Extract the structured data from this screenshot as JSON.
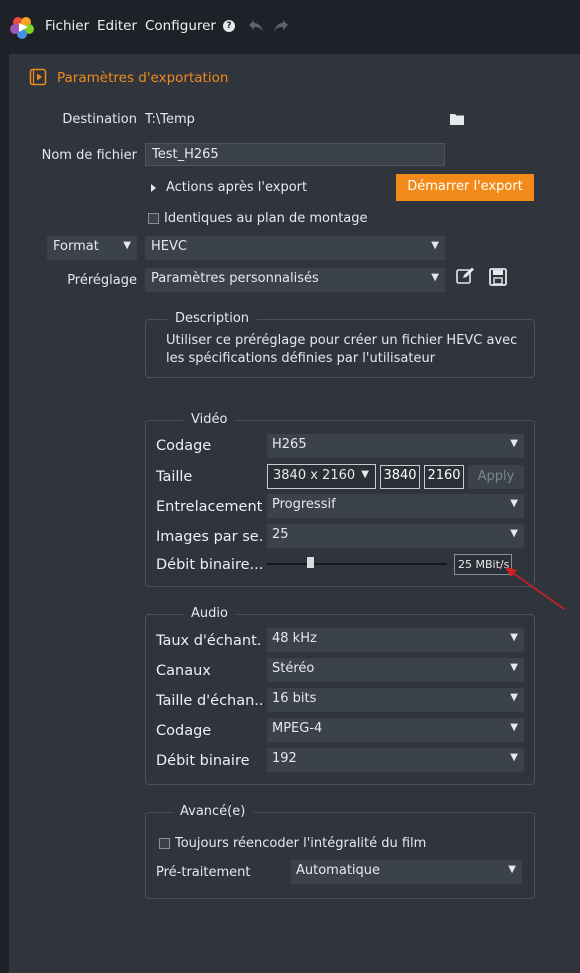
{
  "menu": {
    "items": [
      "Fichier",
      "Editer",
      "Configurer"
    ],
    "help_icon": "help-icon",
    "undo_icon": "undo-icon",
    "redo_icon": "redo-icon"
  },
  "panel": {
    "title": "Paramètres d'exportation",
    "destination_label": "Destination",
    "destination_value": "T:\\Temp",
    "filename_label": "Nom de fichier",
    "filename_value": "Test_H265",
    "actions_label": "Actions après l'export",
    "start_button": "Démarrer l'export",
    "same_as_timeline_label": "Identiques au plan de montage",
    "format_label": "Format",
    "format_value": "HEVC",
    "preset_label": "Préréglage",
    "preset_value": "Paramètres personnalisés",
    "description": {
      "title": "Description",
      "line1": "Utiliser ce préréglage pour créer un fichier HEVC avec",
      "line2": "les spécifications définies par l'utilisateur"
    },
    "video": {
      "title": "Vidéo",
      "encoding_label": "Codage",
      "encoding_value": "H265",
      "size_label": "Taille",
      "size_value": "3840 x 2160",
      "width_value": "3840",
      "height_value": "2160",
      "apply_label": "Apply",
      "interlace_label": "Entrelacement",
      "interlace_value": "Progressif",
      "fps_label": "Images par se...",
      "fps_value": "25",
      "bitrate_label": "Débit binaire...",
      "bitrate_value": "25 MBit/s",
      "bitrate_slider_fraction": 0.24
    },
    "audio": {
      "title": "Audio",
      "samplerate_label": "Taux d'échant...",
      "samplerate_value": "48 kHz",
      "channels_label": "Canaux",
      "channels_value": "Stéréo",
      "samplesize_label": "Taille d'échan...",
      "samplesize_value": "16 bits",
      "encoding_label": "Codage",
      "encoding_value": "MPEG-4",
      "bitrate_label": "Débit binaire",
      "bitrate_value": "192"
    },
    "advanced": {
      "title": "Avancé(e)",
      "reencode_label": "Toujours réencoder l'intégralité du film",
      "preprocess_label": "Pré-traitement",
      "preprocess_value": "Automatique"
    }
  },
  "colors": {
    "accent": "#f08a1c",
    "panel": "#2f343d",
    "background": "#1e2127",
    "annotation_arrow": "#d42020"
  }
}
